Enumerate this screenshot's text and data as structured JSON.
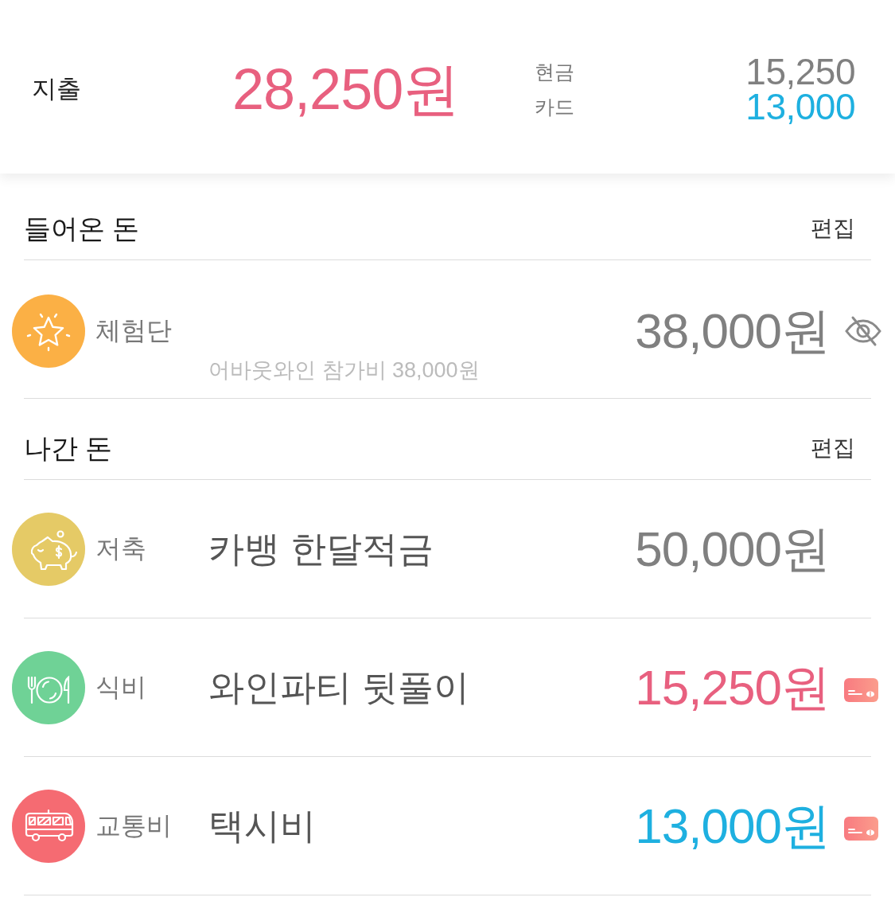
{
  "summary": {
    "label": "지출",
    "total": "28,250원",
    "breakdown": [
      {
        "label": "현금",
        "value": "15,250",
        "color": "#808080"
      },
      {
        "label": "카드",
        "value": "13,000",
        "color": "#1eb0e0"
      }
    ]
  },
  "income": {
    "title": "들어온 돈",
    "edit": "편집",
    "items": [
      {
        "icon": {
          "kind": "star",
          "color": "#fbb045"
        },
        "category": "체험단",
        "memo": "어바웃와인 참가비 38,000원",
        "amount": {
          "text": "38,000원",
          "color": "#808080"
        },
        "badge": {
          "kind": "hidden"
        }
      }
    ]
  },
  "expenses": {
    "title": "나간 돈",
    "edit": "편집",
    "items": [
      {
        "icon": {
          "kind": "piggy-bank",
          "color": "#e5ca66"
        },
        "category": "저축",
        "name": "카뱅 한달적금",
        "amount": {
          "text": "50,000원",
          "color": "#808080"
        }
      },
      {
        "icon": {
          "kind": "dining",
          "color": "#6fd296"
        },
        "category": "식비",
        "name": "와인파티 뒷풀이",
        "amount": {
          "text": "15,250원",
          "color": "#e8607f"
        },
        "badge": {
          "kind": "card"
        }
      },
      {
        "icon": {
          "kind": "bus",
          "color": "#f56b72"
        },
        "category": "교통비",
        "name": "택시비",
        "amount": {
          "text": "13,000원",
          "color": "#1eb0e0"
        },
        "badge": {
          "kind": "card"
        }
      }
    ]
  }
}
